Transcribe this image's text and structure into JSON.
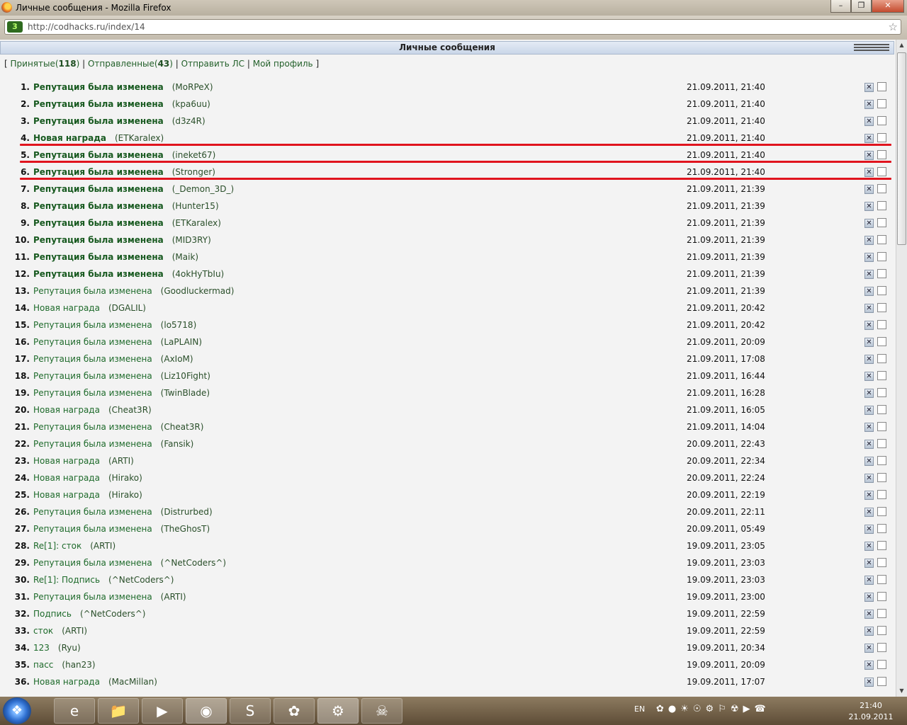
{
  "window": {
    "title": "Личные сообщения - Mozilla Firefox"
  },
  "address": {
    "url": "http://codhacks.ru/index/14"
  },
  "panel": {
    "header": "Личные сообщения"
  },
  "menu": {
    "open_bracket": "[ ",
    "received_label": "Принятые(",
    "received_count": "118",
    "received_close": ")",
    "sep1": " | ",
    "sent_label": "Отправленные(",
    "sent_count": "43",
    "sent_close": ")",
    "sep2": " | ",
    "send_label": "Отправить ЛС",
    "sep3": " | ",
    "profile_label": "Мой профиль",
    "close_bracket": " ]"
  },
  "messages": [
    {
      "num": "1.",
      "subject": "Репутация была изменена",
      "sender": "(MoRPeX)",
      "date": "21.09.2011, 21:40",
      "unread": true
    },
    {
      "num": "2.",
      "subject": "Репутация была изменена",
      "sender": "(kpa6uu)",
      "date": "21.09.2011, 21:40",
      "unread": true
    },
    {
      "num": "3.",
      "subject": "Репутация была изменена",
      "sender": "(d3z4R)",
      "date": "21.09.2011, 21:40",
      "unread": true
    },
    {
      "num": "4.",
      "subject": "Новая награда",
      "sender": "(ETKaralex)",
      "date": "21.09.2011, 21:40",
      "unread": true
    },
    {
      "num": "5.",
      "subject": "Репутация была изменена",
      "sender": "(ineket67)",
      "date": "21.09.2011, 21:40",
      "unread": true
    },
    {
      "num": "6.",
      "subject": "Репутация была изменена",
      "sender": "(Stronger)",
      "date": "21.09.2011, 21:40",
      "unread": true
    },
    {
      "num": "7.",
      "subject": "Репутация была изменена",
      "sender": "(_Demon_3D_)",
      "date": "21.09.2011, 21:39",
      "unread": true
    },
    {
      "num": "8.",
      "subject": "Репутация была изменена",
      "sender": "(Hunter15)",
      "date": "21.09.2011, 21:39",
      "unread": true
    },
    {
      "num": "9.",
      "subject": "Репутация была изменена",
      "sender": "(ETKaralex)",
      "date": "21.09.2011, 21:39",
      "unread": true
    },
    {
      "num": "10.",
      "subject": "Репутация была изменена",
      "sender": "(MID3RY)",
      "date": "21.09.2011, 21:39",
      "unread": true
    },
    {
      "num": "11.",
      "subject": "Репутация была изменена",
      "sender": "(Maik)",
      "date": "21.09.2011, 21:39",
      "unread": true
    },
    {
      "num": "12.",
      "subject": "Репутация была изменена",
      "sender": "(4okHyTbIu)",
      "date": "21.09.2011, 21:39",
      "unread": true
    },
    {
      "num": "13.",
      "subject": "Репутация была изменена",
      "sender": "(Goodluckermad)",
      "date": "21.09.2011, 21:39",
      "unread": false
    },
    {
      "num": "14.",
      "subject": "Новая награда",
      "sender": "(DGALIL)",
      "date": "21.09.2011, 20:42",
      "unread": false
    },
    {
      "num": "15.",
      "subject": "Репутация была изменена",
      "sender": "(lo5718)",
      "date": "21.09.2011, 20:42",
      "unread": false
    },
    {
      "num": "16.",
      "subject": "Репутация была изменена",
      "sender": "(LaPLAIN)",
      "date": "21.09.2011, 20:09",
      "unread": false
    },
    {
      "num": "17.",
      "subject": "Репутация была изменена",
      "sender": "(AxIoM)",
      "date": "21.09.2011, 17:08",
      "unread": false
    },
    {
      "num": "18.",
      "subject": "Репутация была изменена",
      "sender": "(Liz10Fight)",
      "date": "21.09.2011, 16:44",
      "unread": false
    },
    {
      "num": "19.",
      "subject": "Репутация была изменена",
      "sender": "(TwinBlade)",
      "date": "21.09.2011, 16:28",
      "unread": false
    },
    {
      "num": "20.",
      "subject": "Новая награда",
      "sender": "(Cheat3R)",
      "date": "21.09.2011, 16:05",
      "unread": false
    },
    {
      "num": "21.",
      "subject": "Репутация была изменена",
      "sender": "(Cheat3R)",
      "date": "21.09.2011, 14:04",
      "unread": false
    },
    {
      "num": "22.",
      "subject": "Репутация была изменена",
      "sender": "(Fansik)",
      "date": "20.09.2011, 22:43",
      "unread": false
    },
    {
      "num": "23.",
      "subject": "Новая награда",
      "sender": "(ARTI)",
      "date": "20.09.2011, 22:34",
      "unread": false
    },
    {
      "num": "24.",
      "subject": "Новая награда",
      "sender": "(Hirako)",
      "date": "20.09.2011, 22:24",
      "unread": false
    },
    {
      "num": "25.",
      "subject": "Новая награда",
      "sender": "(Hirako)",
      "date": "20.09.2011, 22:19",
      "unread": false
    },
    {
      "num": "26.",
      "subject": "Репутация была изменена",
      "sender": "(Distrurbed)",
      "date": "20.09.2011, 22:11",
      "unread": false
    },
    {
      "num": "27.",
      "subject": "Репутация была изменена",
      "sender": "(TheGhosT)",
      "date": "20.09.2011, 05:49",
      "unread": false
    },
    {
      "num": "28.",
      "subject": "Re[1]: сток",
      "sender": "(ARTI)",
      "date": "19.09.2011, 23:05",
      "unread": false
    },
    {
      "num": "29.",
      "subject": "Репутация была изменена",
      "sender": "(^NetCoders^)",
      "date": "19.09.2011, 23:03",
      "unread": false
    },
    {
      "num": "30.",
      "subject": "Re[1]: Подпись",
      "sender": "(^NetCoders^)",
      "date": "19.09.2011, 23:03",
      "unread": false
    },
    {
      "num": "31.",
      "subject": "Репутация была изменена",
      "sender": "(ARTI)",
      "date": "19.09.2011, 23:00",
      "unread": false
    },
    {
      "num": "32.",
      "subject": "Подпись",
      "sender": "(^NetCoders^)",
      "date": "19.09.2011, 22:59",
      "unread": false
    },
    {
      "num": "33.",
      "subject": "сток",
      "sender": "(ARTI)",
      "date": "19.09.2011, 22:59",
      "unread": false
    },
    {
      "num": "34.",
      "subject": "123",
      "sender": "(Ryu)",
      "date": "19.09.2011, 20:34",
      "unread": false
    },
    {
      "num": "35.",
      "subject": "пасс",
      "sender": "(han23)",
      "date": "19.09.2011, 20:09",
      "unread": false
    },
    {
      "num": "36.",
      "subject": "Новая награда",
      "sender": "(MacMillan)",
      "date": "19.09.2011, 17:07",
      "unread": false
    }
  ],
  "highlight_after_rows": [
    4,
    5,
    6
  ],
  "taskbar": {
    "lang": "EN",
    "time": "21:40",
    "date": "21.09.2011",
    "apps": [
      "internet-explorer-icon",
      "folder-icon",
      "media-player-icon",
      "firefox-icon",
      "skype-icon",
      "icq-icon",
      "steam-icon",
      "game-icon"
    ]
  },
  "colors": {
    "accent_red": "#e0141e",
    "link_green": "#1d6a2a"
  }
}
